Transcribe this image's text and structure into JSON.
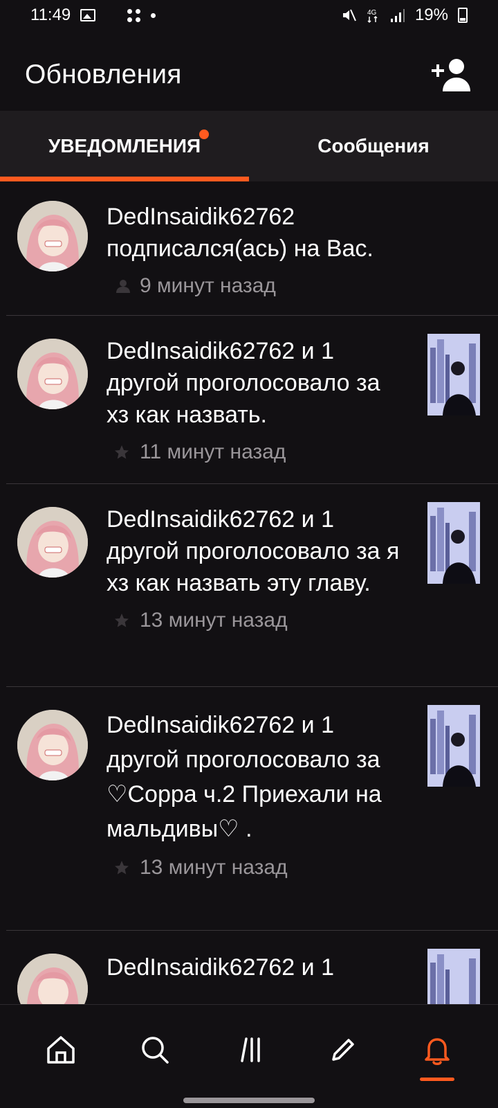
{
  "status_bar": {
    "time": "11:49",
    "battery": "19%",
    "icons_left": [
      "gallery-icon",
      "app-grid-icon",
      "dots-icon",
      "notification-dot-icon"
    ],
    "icons_right": [
      "mute-icon",
      "network-4g-icon",
      "signal-icon",
      "battery-icon"
    ]
  },
  "header": {
    "title": "Обновления",
    "action_icon": "add-user-icon"
  },
  "tabs": [
    {
      "label": "УВЕДОМЛЕНИЯ",
      "active": true,
      "has_badge": true
    },
    {
      "label": "Сообщения",
      "active": false,
      "has_badge": false
    }
  ],
  "notifications": [
    {
      "text": "DedInsaidik62762 подписался(ась) на Вас.",
      "time": "9 минут назад",
      "icon": "follower-icon",
      "has_thumb": false
    },
    {
      "text": "DedInsaidik62762 и 1 другой проголосовало за хз как назвать.",
      "time": "11 минут назад",
      "icon": "star-icon",
      "has_thumb": true
    },
    {
      "text": "DedInsaidik62762 и 1 другой проголосовало за я хз как назвать эту главу.",
      "time": "13 минут назад",
      "icon": "star-icon",
      "has_thumb": true
    },
    {
      "text": "DedInsaidik62762 и 1 другой проголосовало за ♡Соррa ч.2 Приехали на мальдивы♡ .",
      "time": "13 минут назад",
      "icon": "star-icon",
      "has_thumb": true
    },
    {
      "text": "DedInsaidik62762 и 1",
      "time": "",
      "icon": "star-icon",
      "has_thumb": true
    }
  ],
  "bottom_nav": [
    {
      "name": "home-icon",
      "active": false
    },
    {
      "name": "search-icon",
      "active": false
    },
    {
      "name": "library-icon",
      "active": false
    },
    {
      "name": "write-icon",
      "active": false
    },
    {
      "name": "notifications-bell-icon",
      "active": true
    }
  ],
  "colors": {
    "accent": "#ff5a1f",
    "background": "#121013",
    "tab_bar": "#1f1c1f",
    "muted_text": "#9a969a"
  }
}
